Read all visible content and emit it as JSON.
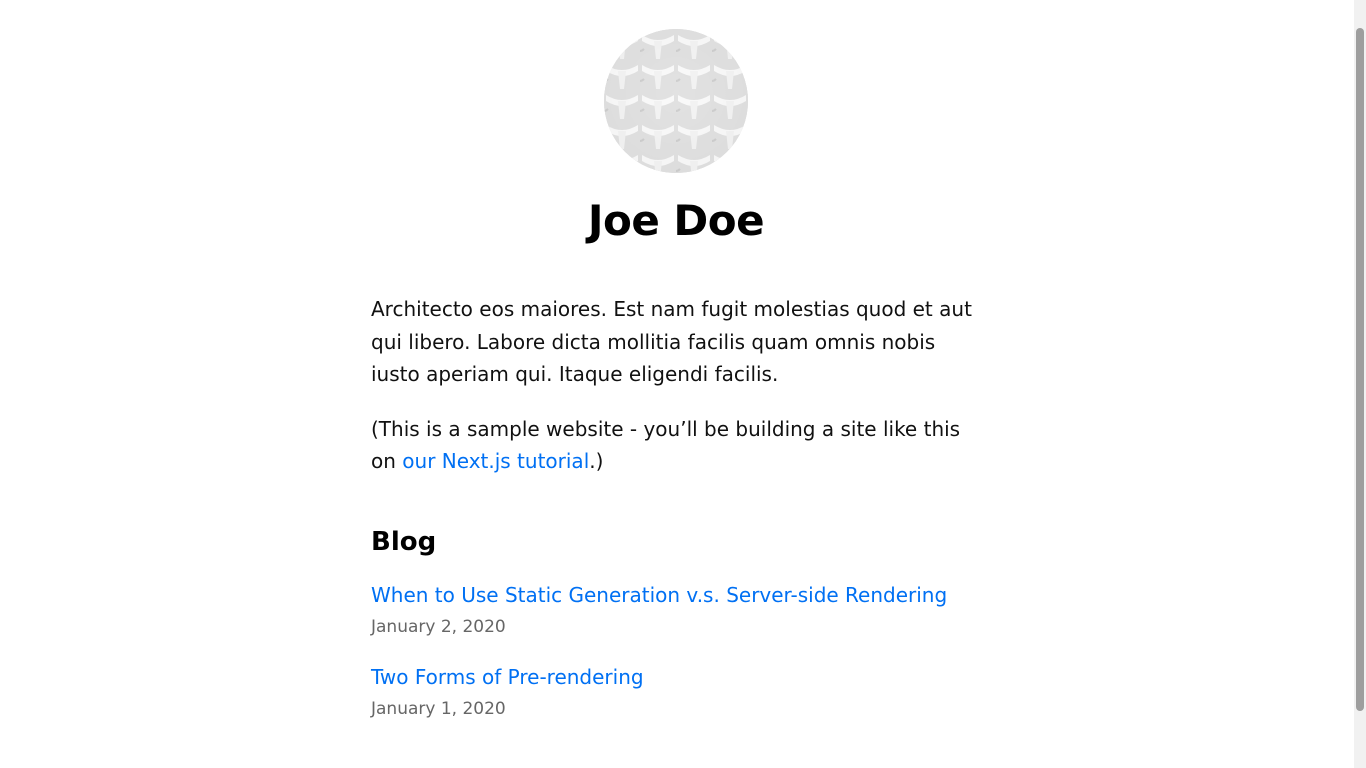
{
  "profile": {
    "avatar_alt": "avatar-image",
    "name": "Joe Doe"
  },
  "intro": {
    "bio": "Architecto eos maiores. Est nam fugit molestias quod et aut qui libero. Labore dicta mollitia facilis quam omnis nobis iusto aperiam qui. Itaque eligendi facilis.",
    "note_prefix": "(This is a sample website - you’ll be building a site like this on ",
    "note_link": "our Next.js tutorial",
    "note_suffix": ".)"
  },
  "blog": {
    "heading": "Blog",
    "posts": [
      {
        "title": "When to Use Static Generation v.s. Server-side Rendering",
        "date": "January 2, 2020"
      },
      {
        "title": "Two Forms of Pre-rendering",
        "date": "January 1, 2020"
      }
    ]
  },
  "colors": {
    "link": "#0070f3",
    "text": "#111111",
    "date": "#666666",
    "background": "#ffffff"
  }
}
